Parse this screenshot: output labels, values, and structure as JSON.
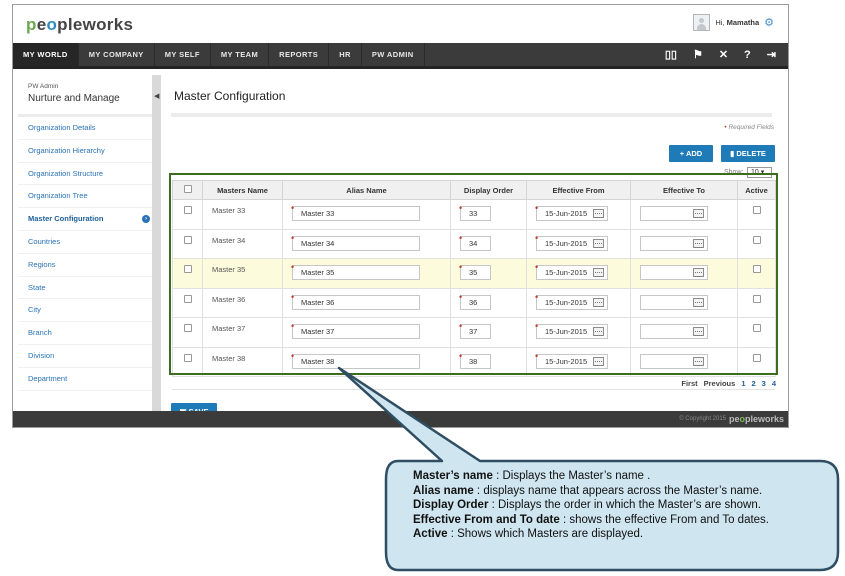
{
  "app": {
    "logo": {
      "prefix": "p",
      "part1": "e",
      "mid": "o",
      "part2": "pleworks"
    },
    "greeting": "Hi, ",
    "user_name": "Mamatha"
  },
  "nav": {
    "tabs": [
      "MY WORLD",
      "MY COMPANY",
      "MY SELF",
      "MY TEAM",
      "REPORTS",
      "HR",
      "PW ADMIN"
    ],
    "icons": [
      "book-icon",
      "flag-icon",
      "tools-icon",
      "help-icon",
      "logout-icon"
    ]
  },
  "sidebar": {
    "subtitle": "PW Admin",
    "title": "Nurture and Manage",
    "items": [
      "Organization Details",
      "Organization Hierarchy",
      "Organization Structure",
      "Organization Tree",
      "Master Configuration",
      "Countries",
      "Regions",
      "State",
      "City",
      "Branch",
      "Division",
      "Department"
    ],
    "active_index": 4
  },
  "main": {
    "title": "Master Configuration",
    "required_note": "Required Fields",
    "add_label": "+ ADD",
    "delete_label": "DELETE",
    "show_label": "Show:",
    "show_value": "10 ▾",
    "columns": [
      "",
      "Masters Name",
      "Alias Name",
      "Display Order",
      "Effective From",
      "Effective To",
      "Active"
    ],
    "rows": [
      {
        "name": "Master 33",
        "alias": "Master 33",
        "order": "33",
        "from": "15-Jun-2015",
        "to": ""
      },
      {
        "name": "Master 34",
        "alias": "Master 34",
        "order": "34",
        "from": "15-Jun-2015",
        "to": ""
      },
      {
        "name": "Master 35",
        "alias": "Master 35",
        "order": "35",
        "from": "15-Jun-2015",
        "to": ""
      },
      {
        "name": "Master 36",
        "alias": "Master 36",
        "order": "36",
        "from": "15-Jun-2015",
        "to": ""
      },
      {
        "name": "Master 37",
        "alias": "Master 37",
        "order": "37",
        "from": "15-Jun-2015",
        "to": ""
      },
      {
        "name": "Master 38",
        "alias": "Master 38",
        "order": "38",
        "from": "15-Jun-2015",
        "to": ""
      }
    ],
    "pager": {
      "first": "First",
      "previous": "Previous",
      "pages": [
        "1",
        "2",
        "3",
        "4"
      ]
    },
    "save_label": "SAVE"
  },
  "footer": {
    "copyright": "© Copyright 2015",
    "logo_a": "pe",
    "logo_o": "o",
    "logo_b": "pleworks"
  },
  "callout": [
    {
      "term": "Master’s name",
      "text": " : Displays the Master’s name ."
    },
    {
      "term": "Alias name",
      "text": " : displays name that appears across the Master’s name."
    },
    {
      "term": "Display Order",
      "text": " : Displays the order in which the Master’s are  shown."
    },
    {
      "term": "Effective From and To date",
      "text": " : shows the effective From and To dates."
    },
    {
      "term": "Active",
      "text": " : Shows which Masters are displayed."
    }
  ]
}
